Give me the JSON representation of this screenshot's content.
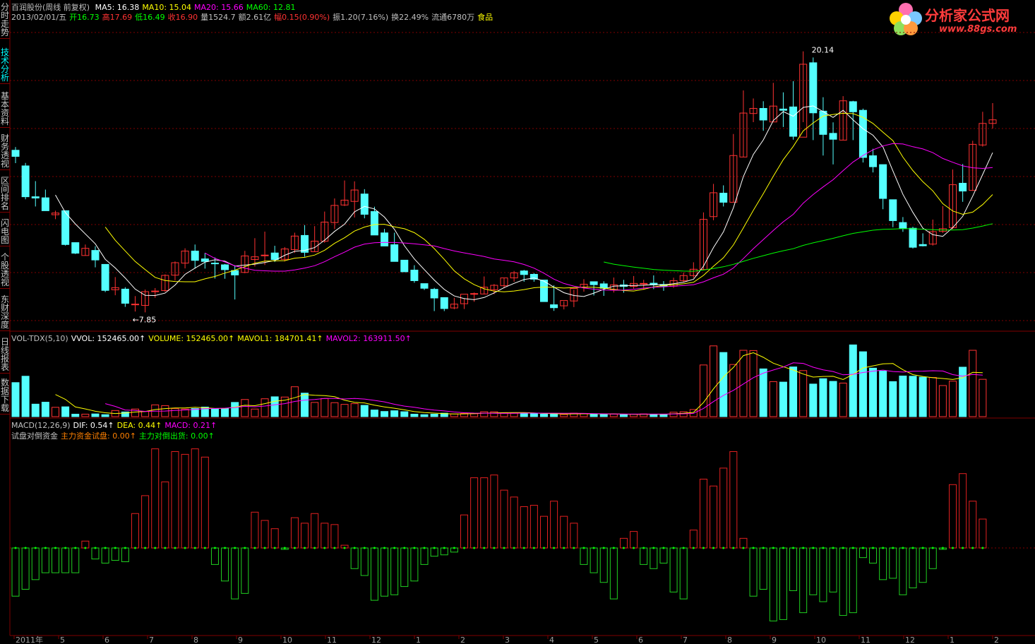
{
  "side_tabs": [
    {
      "label": "分时走势",
      "active": false
    },
    {
      "label": "技术分析",
      "active": true
    },
    {
      "label": "基本资料",
      "active": false
    },
    {
      "label": "财务透视",
      "active": false
    },
    {
      "label": "区间排名",
      "active": false
    },
    {
      "label": "闪电图",
      "active": false
    },
    {
      "label": "个股透视",
      "active": false
    },
    {
      "label": "东财深度",
      "active": false
    },
    {
      "label": "日线报表",
      "active": false
    },
    {
      "label": "数据下载",
      "active": false
    }
  ],
  "header": {
    "stock": "百润股份(周线 前复权)",
    "ma": [
      {
        "t": "MA5: 16.38",
        "c": "#ffffff"
      },
      {
        "t": "MA10: 15.04",
        "c": "#ffff00"
      },
      {
        "t": "MA20: 15.66",
        "c": "#ff00ff"
      },
      {
        "t": "MA60: 12.81",
        "c": "#00ff00"
      }
    ],
    "info": [
      {
        "t": "2013/02/01/五",
        "c": "#c0c0c0"
      },
      {
        "t": "开16.73",
        "c": "#00ff00"
      },
      {
        "t": "高17.69",
        "c": "#ff3232"
      },
      {
        "t": "低16.49",
        "c": "#00ff00"
      },
      {
        "t": "收16.90",
        "c": "#ff3232"
      },
      {
        "t": "量1524.7",
        "c": "#c0c0c0"
      },
      {
        "t": "额2.61亿",
        "c": "#c0c0c0"
      },
      {
        "t": "幅0.15(0.90%)",
        "c": "#ff3232"
      },
      {
        "t": "振1.20(7.16%)",
        "c": "#c0c0c0"
      },
      {
        "t": "换22.49%",
        "c": "#c0c0c0"
      },
      {
        "t": "流通6780万",
        "c": "#c0c0c0"
      },
      {
        "t": "食品",
        "c": "#ffff00"
      }
    ]
  },
  "vol_header": [
    {
      "t": "VOL-TDX(5,10)",
      "c": "#c0c0c0"
    },
    {
      "t": "VVOL: 152465.00",
      "c": "#ffffff"
    },
    {
      "t": "VOLUME: 152465.00",
      "c": "#ffff00"
    },
    {
      "t": "MAVOL1: 184701.41",
      "c": "#ffff00"
    },
    {
      "t": "MAVOL2: 163911.50",
      "c": "#ff00ff"
    }
  ],
  "macd_header": [
    {
      "t": "MACD(12,26,9)",
      "c": "#c0c0c0"
    },
    {
      "t": "DIF: 0.54",
      "c": "#ffffff"
    },
    {
      "t": "DEA: 0.44",
      "c": "#ffff00"
    },
    {
      "t": "MACD: 0.21",
      "c": "#ff00ff"
    }
  ],
  "macd_header2": [
    {
      "t": "试盘对倒资金",
      "c": "#c0c0c0"
    },
    {
      "t": "主力资金试盘: 0.00",
      "c": "#ff8000"
    },
    {
      "t": "主力对倒出货: 0.00",
      "c": "#00ff00"
    }
  ],
  "logo": {
    "title": "分析家公式网",
    "url": "www.88gs.com"
  },
  "annotations": {
    "high": "20.14",
    "low": "7.85"
  },
  "x_labels": [
    "2011年",
    "5",
    "6",
    "7",
    "8",
    "9",
    "10",
    "11",
    "12",
    "1",
    "2",
    "3",
    "4",
    "5",
    "6",
    "7",
    "8",
    "9",
    "10",
    "11",
    "12",
    "1",
    "2"
  ],
  "colors": {
    "up": "#ff3232",
    "down": "#54ffff",
    "ma5": "#ffffff",
    "ma10": "#ffff00",
    "ma20": "#ff00ff",
    "ma60": "#00ff00",
    "grid": "#800000"
  },
  "chart_data": {
    "type": "candlestick",
    "price_ylim": [
      7.0,
      21.5
    ],
    "candles": [
      [
        15.46,
        15.17,
        15.61,
        14.85
      ],
      [
        14.72,
        13.26,
        14.86,
        13.14
      ],
      [
        13.26,
        13.2,
        14.0,
        12.8
      ],
      [
        13.21,
        12.6,
        13.6,
        12.6
      ],
      [
        12.41,
        12.49,
        12.6,
        12.2
      ],
      [
        12.6,
        11.0,
        12.6,
        10.95
      ],
      [
        11.09,
        10.59,
        11.09,
        10.55
      ],
      [
        10.48,
        10.82,
        11.0,
        10.48
      ],
      [
        10.72,
        10.27,
        10.92,
        9.92
      ],
      [
        10.06,
        8.83,
        10.06,
        8.75
      ],
      [
        8.86,
        8.96,
        9.46,
        8.6
      ],
      [
        8.89,
        8.22,
        8.98,
        8.05
      ],
      [
        8.17,
        8.18,
        8.56,
        7.83
      ],
      [
        8.12,
        8.77,
        8.87,
        7.79
      ],
      [
        8.79,
        8.8,
        8.94,
        8.48
      ],
      [
        8.82,
        9.54,
        9.59,
        8.76
      ],
      [
        9.55,
        10.14,
        10.2,
        9.3
      ],
      [
        10.12,
        10.69,
        10.82,
        9.87
      ],
      [
        10.69,
        10.25,
        11.0,
        9.86
      ],
      [
        10.32,
        10.2,
        10.6,
        9.86
      ],
      [
        10.12,
        10.1,
        10.39,
        9.39
      ],
      [
        10.04,
        9.81,
        10.08,
        9.38
      ],
      [
        9.77,
        9.56,
        10.02,
        8.4
      ],
      [
        9.68,
        10.46,
        10.7,
        9.64
      ],
      [
        10.29,
        10.42,
        11.3,
        9.96
      ],
      [
        10.5,
        10.5,
        11.61,
        10.03
      ],
      [
        10.6,
        10.29,
        10.94,
        10.17
      ],
      [
        10.3,
        10.79,
        10.88,
        10.2
      ],
      [
        10.76,
        11.4,
        11.56,
        10.6
      ],
      [
        11.43,
        10.63,
        11.92,
        10.42
      ],
      [
        10.66,
        11.16,
        11.87,
        10.66
      ],
      [
        11.16,
        12.06,
        12.56,
        11.08
      ],
      [
        12.04,
        12.85,
        13.18,
        11.73
      ],
      [
        12.87,
        13.1,
        14.03,
        12.82
      ],
      [
        13.04,
        13.58,
        13.99,
        12.28
      ],
      [
        13.39,
        12.43,
        13.62,
        12.24
      ],
      [
        12.56,
        11.45,
        12.79,
        11.45
      ],
      [
        11.55,
        10.93,
        11.74,
        10.93
      ],
      [
        10.99,
        10.2,
        11.56,
        10.19
      ],
      [
        10.26,
        9.71,
        10.24,
        9.71
      ],
      [
        9.79,
        9.29,
        10.02,
        9.19
      ],
      [
        9.15,
        8.93,
        9.01,
        8.85
      ],
      [
        8.88,
        8.47,
        8.95,
        7.85
      ],
      [
        8.49,
        7.97,
        8.48,
        7.85
      ],
      [
        8.0,
        8.18,
        8.48,
        7.94
      ],
      [
        8.2,
        8.65,
        8.47,
        7.95
      ],
      [
        8.67,
        8.68,
        8.73,
        8.29
      ],
      [
        8.66,
        8.98,
        9.49,
        8.64
      ],
      [
        8.86,
        9.07,
        9.13,
        8.65
      ],
      [
        9.05,
        9.42,
        9.41,
        8.93
      ],
      [
        9.42,
        9.66,
        9.75,
        9.24
      ],
      [
        9.75,
        9.58,
        9.8,
        9.24
      ],
      [
        9.59,
        9.36,
        9.65,
        9.24
      ],
      [
        9.32,
        8.3,
        9.21,
        8.3
      ],
      [
        8.15,
        8.01,
        9.07,
        7.86
      ],
      [
        8.1,
        8.35,
        8.31,
        7.93
      ],
      [
        8.33,
        8.92,
        8.86,
        8.04
      ],
      [
        8.97,
        9.12,
        9.36,
        8.77
      ],
      [
        9.24,
        9.1,
        9.13,
        8.59
      ],
      [
        9.14,
        8.93,
        9.26,
        8.57
      ],
      [
        8.85,
        9.09,
        9.44,
        8.73
      ],
      [
        9.09,
        9.02,
        9.33,
        8.72
      ],
      [
        9.02,
        9.16,
        9.51,
        8.91
      ],
      [
        9.15,
        9.16,
        9.33,
        8.86
      ],
      [
        9.17,
        9.09,
        9.54,
        8.89
      ],
      [
        9.11,
        9.03,
        9.27,
        8.81
      ],
      [
        9.03,
        9.29,
        9.43,
        8.95
      ],
      [
        9.29,
        9.53,
        9.68,
        9.23
      ],
      [
        9.53,
        9.83,
        10.16,
        9.42
      ],
      [
        9.82,
        12.19,
        12.52,
        9.79
      ],
      [
        12.32,
        13.45,
        13.87,
        12.15
      ],
      [
        13.43,
        13.0,
        13.8,
        12.8
      ],
      [
        13.0,
        15.21,
        16.23,
        13.0
      ],
      [
        15.14,
        17.22,
        18.29,
        15.14
      ],
      [
        17.2,
        17.44,
        17.91,
        16.79
      ],
      [
        17.44,
        16.89,
        17.78,
        16.38
      ],
      [
        16.8,
        17.55,
        18.65,
        16.79
      ],
      [
        17.41,
        17.35,
        18.2,
        16.56
      ],
      [
        17.51,
        16.12,
        18.73,
        15.96
      ],
      [
        16.08,
        19.53,
        20.14,
        16.79
      ],
      [
        19.6,
        17.23,
        19.85,
        15.94
      ],
      [
        17.31,
        16.21,
        17.97,
        15.21
      ],
      [
        16.26,
        15.98,
        16.78,
        14.79
      ],
      [
        15.94,
        17.8,
        18.02,
        15.94
      ],
      [
        17.76,
        17.28,
        17.8,
        15.94
      ],
      [
        17.35,
        15.12,
        17.43,
        14.88
      ],
      [
        15.2,
        14.68,
        15.53,
        14.41
      ],
      [
        14.78,
        13.18,
        14.51,
        12.67
      ],
      [
        13.12,
        12.13,
        12.86,
        11.82
      ],
      [
        12.04,
        11.76,
        12.3,
        11.6
      ],
      [
        11.77,
        10.87,
        11.84,
        10.81
      ],
      [
        11.0,
        10.94,
        11.53,
        10.91
      ],
      [
        11.02,
        11.61,
        12.18,
        10.95
      ],
      [
        11.62,
        11.75,
        12.82,
        11.55
      ],
      [
        11.8,
        13.83,
        14.55,
        11.72
      ],
      [
        13.9,
        13.53,
        14.81,
        13.02
      ],
      [
        13.56,
        15.74,
        15.91,
        13.54
      ],
      [
        15.71,
        16.73,
        17.28,
        15.63
      ],
      [
        16.73,
        16.9,
        17.69,
        16.49
      ]
    ],
    "volume_ylim": [
      0,
      300000
    ],
    "volumes": [
      139000,
      165000,
      51000,
      59000,
      38000,
      40000,
      10000,
      10000,
      11000,
      8000,
      25000,
      19000,
      31000,
      21000,
      48000,
      45000,
      33000,
      31000,
      33000,
      39000,
      32000,
      33000,
      58000,
      70000,
      31000,
      73000,
      81000,
      80000,
      122000,
      96000,
      58000,
      74000,
      57000,
      50000,
      53000,
      46000,
      27000,
      21000,
      24000,
      20000,
      10000,
      8000,
      10000,
      14000,
      11000,
      13000,
      12000,
      20000,
      20000,
      16000,
      14000,
      13000,
      12000,
      10000,
      11000,
      9000,
      14000,
      13000,
      10000,
      9000,
      10000,
      8000,
      10000,
      11000,
      10000,
      9000,
      18000,
      20000,
      29000,
      211000,
      289000,
      262000,
      213000,
      271000,
      270000,
      195000,
      143000,
      141000,
      203000,
      188000,
      133000,
      155000,
      144000,
      137000,
      293000,
      265000,
      198000,
      186000,
      143000,
      166000,
      165000,
      161000,
      160000,
      127000,
      145000,
      202000,
      271000,
      152465
    ],
    "macd_ylim": [
      -0.5,
      0.8
    ],
    "macd": [
      -0.35,
      -0.3,
      -0.23,
      -0.18,
      -0.18,
      -0.18,
      -0.18,
      0.05,
      -0.08,
      -0.11,
      -0.09,
      -0.1,
      0.25,
      0.38,
      0.72,
      0.48,
      0.7,
      0.68,
      0.72,
      0.66,
      -0.12,
      -0.24,
      -0.37,
      -0.33,
      0.26,
      0.2,
      0.14,
      -0.01,
      0.22,
      0.18,
      0.25,
      0.18,
      0.17,
      0.02,
      -0.15,
      -0.2,
      -0.38,
      -0.35,
      -0.34,
      -0.28,
      -0.24,
      -0.12,
      -0.06,
      -0.05,
      -0.03,
      0.24,
      0.51,
      0.51,
      0.53,
      0.42,
      0.37,
      0.3,
      0.31,
      0.23,
      0.34,
      0.23,
      0.18,
      -0.12,
      -0.18,
      -0.25,
      -0.37,
      0.07,
      0.12,
      -0.12,
      -0.15,
      -0.11,
      -0.32,
      -0.37,
      0.13,
      0.5,
      0.45,
      0.58,
      0.7,
      0.07,
      -0.35,
      -0.3,
      -0.53,
      -0.52,
      -0.31,
      -0.47,
      -0.34,
      -0.39,
      -0.32,
      -0.49,
      -0.47,
      -0.07,
      -0.11,
      -0.23,
      -0.22,
      -0.34,
      -0.29,
      -0.25,
      -0.15,
      -0.01,
      0.46,
      0.54,
      0.34,
      0.21
    ]
  }
}
